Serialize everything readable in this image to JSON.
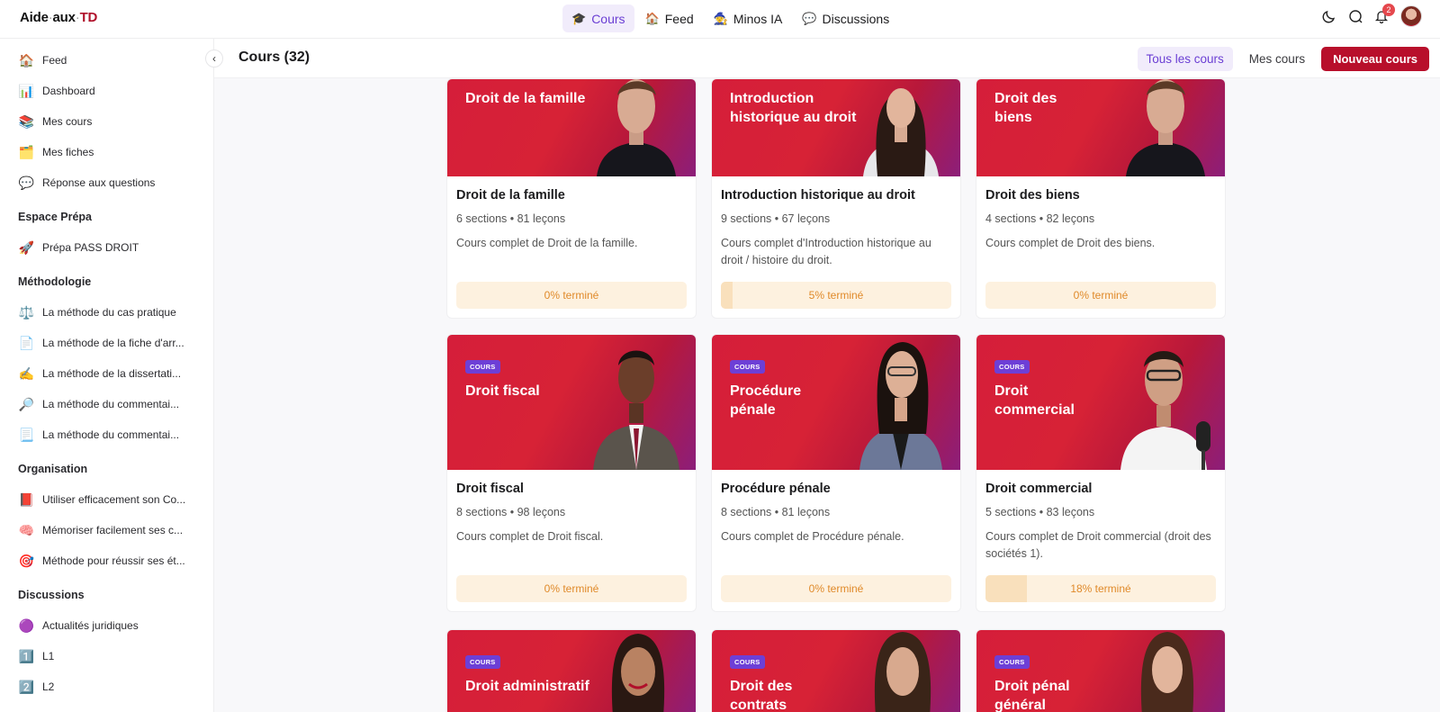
{
  "brand": {
    "part1": "Aide",
    "part2": "aux",
    "part3": "TD"
  },
  "topnav": [
    {
      "emoji": "🎓",
      "label": "Cours"
    },
    {
      "emoji": "🏠",
      "label": "Feed"
    },
    {
      "emoji": "🧙",
      "label": "Minos IA"
    },
    {
      "emoji": "💬",
      "label": "Discussions"
    }
  ],
  "notifications": {
    "count": "2"
  },
  "sidebar": {
    "main": [
      {
        "emoji": "🏠",
        "label": "Feed"
      },
      {
        "emoji": "📊",
        "label": "Dashboard"
      },
      {
        "emoji": "📚",
        "label": "Mes cours"
      },
      {
        "emoji": "🗂️",
        "label": "Mes fiches"
      },
      {
        "emoji": "💬",
        "label": "Réponse aux questions"
      }
    ],
    "sections": [
      {
        "title": "Espace Prépa",
        "items": [
          {
            "emoji": "🚀",
            "label": "Prépa PASS DROIT"
          }
        ]
      },
      {
        "title": "Méthodologie",
        "items": [
          {
            "emoji": "⚖️",
            "label": "La méthode du cas pratique"
          },
          {
            "emoji": "📄",
            "label": "La méthode de la fiche d'arr..."
          },
          {
            "emoji": "✍️",
            "label": "La méthode de la dissertati..."
          },
          {
            "emoji": "🔎",
            "label": "La méthode du commentai..."
          },
          {
            "emoji": "📃",
            "label": "La méthode du commentai..."
          }
        ]
      },
      {
        "title": "Organisation",
        "items": [
          {
            "emoji": "📕",
            "label": "Utiliser efficacement son Co..."
          },
          {
            "emoji": "🧠",
            "label": "Mémoriser facilement ses c..."
          },
          {
            "emoji": "🎯",
            "label": "Méthode pour réussir ses ét..."
          }
        ]
      },
      {
        "title": "Discussions",
        "items": [
          {
            "emoji": "🟣",
            "label": "Actualités juridiques"
          },
          {
            "emoji": "1️⃣",
            "label": "L1"
          },
          {
            "emoji": "2️⃣",
            "label": "L2"
          }
        ]
      }
    ]
  },
  "page": {
    "title": "Cours (32)"
  },
  "filters": {
    "all": "Tous les cours",
    "mine": "Mes cours",
    "new": "Nouveau cours"
  },
  "chip_label": "COURS",
  "courses": [
    {
      "banner": "Droit de la famille",
      "name": "Droit de la famille",
      "meta": "6 sections • 81 leçons",
      "desc": "Cours complet de Droit de la famille.",
      "progress": "0% terminé",
      "pct": 0
    },
    {
      "banner": "Introduction historique au droit",
      "name": "Introduction historique au droit",
      "meta": "9 sections • 67 leçons",
      "desc": "Cours complet d'Introduction historique au droit / histoire du droit.",
      "progress": "5% terminé",
      "pct": 5
    },
    {
      "banner": "Droit des biens",
      "name": "Droit des biens",
      "meta": "4 sections • 82 leçons",
      "desc": "Cours complet de Droit des biens.",
      "progress": "0% terminé",
      "pct": 0
    },
    {
      "banner": "Droit fiscal",
      "name": "Droit fiscal",
      "meta": "8 sections • 98 leçons",
      "desc": "Cours complet de Droit fiscal.",
      "progress": "0% terminé",
      "pct": 0
    },
    {
      "banner": "Procédure pénale",
      "name": "Procédure pénale",
      "meta": "8 sections • 81 leçons",
      "desc": "Cours complet de Procédure pénale.",
      "progress": "0% terminé",
      "pct": 0
    },
    {
      "banner": "Droit commercial",
      "name": "Droit commercial",
      "meta": "5 sections • 83 leçons",
      "desc": "Cours complet de Droit commercial (droit des sociétés 1).",
      "progress": "18% terminé",
      "pct": 18
    },
    {
      "banner": "Droit administratif"
    },
    {
      "banner": "Droit des contrats"
    },
    {
      "banner": "Droit pénal général"
    }
  ],
  "colors": {
    "brand": "#b80f2b",
    "accent": "#6b3fd4",
    "progress_text": "#e08a2a"
  }
}
